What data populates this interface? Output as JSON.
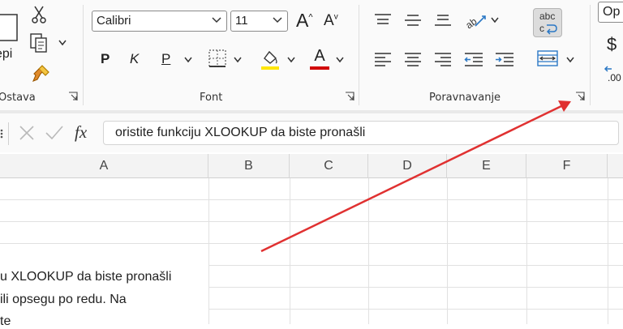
{
  "ribbon": {
    "clipboard": {
      "paste_partial": "epi",
      "group_label": "Ostava"
    },
    "font": {
      "font_name": "Calibri",
      "font_size": "11",
      "bold": "P",
      "italic": "K",
      "underline": "P",
      "grow_label": "A",
      "shrink_label": "A",
      "font_color_label": "A",
      "group_label": "Font",
      "highlight_color": "#ffe600",
      "font_color": "#d10000"
    },
    "alignment": {
      "group_label": "Poravnavanje",
      "wrap_label": "abc"
    },
    "number": {
      "format_partial": "Op",
      "currency_symbol": "$",
      "decimal_label": ".00"
    }
  },
  "formula_bar": {
    "fx_label": "fx",
    "content": "oristite funkciju XLOOKUP da biste pronašli"
  },
  "grid": {
    "columns": [
      "A",
      "B",
      "C",
      "D",
      "E",
      "F"
    ],
    "cell_lines": [
      "u XLOOKUP da biste pronašli",
      " ili opsegu po redu. Na",
      "te"
    ]
  },
  "annotation": {
    "arrow_color": "#e03131"
  }
}
